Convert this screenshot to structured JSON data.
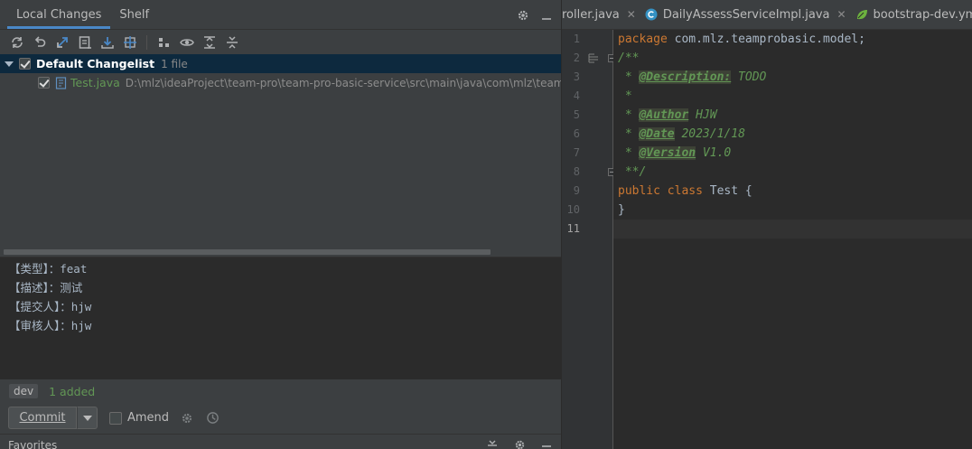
{
  "changes_panel": {
    "tabs": [
      {
        "label": "Local Changes",
        "active": true
      },
      {
        "label": "Shelf",
        "active": false
      }
    ],
    "header_icons": [
      "gear-icon",
      "minimize-icon"
    ],
    "toolbar_icons": [
      "refresh-icon",
      "rollback-icon",
      "diff-icon",
      "changelist-icon",
      "update-icon",
      "shelve-icon",
      "group-by-icon",
      "preview-icon",
      "expand-all-icon",
      "collapse-all-icon"
    ],
    "changelist": {
      "name": "Default Changelist",
      "count": "1 file",
      "files": [
        {
          "name": "Test.java",
          "path": "D:\\mlz\\ideaProject\\team-pro\\team-pro-basic-service\\src\\main\\java\\com\\mlz\\teamp"
        }
      ]
    },
    "commit_message": [
      "【类型】：feat",
      "【描述】：测试",
      "【提交人】：hjw",
      "【审核人】：hjw"
    ],
    "branch": "dev",
    "branch_status": "1 added",
    "commit_button": "Commit",
    "amend_label": "Amend",
    "colors": {
      "accent": "#4a88c7",
      "added": "#629755",
      "selection": "#0d293e"
    }
  },
  "favorites": {
    "title": "Favorites"
  },
  "editor": {
    "tabs": [
      {
        "label": "roller.java",
        "icon": "close-icon"
      },
      {
        "label": "DailyAssessServiceImpl.java",
        "icon": "java-class-icon"
      },
      {
        "label": "bootstrap-dev.yml",
        "icon": "spring-leaf-icon"
      }
    ],
    "close_glyph": "✕",
    "line_numbers": [
      "1",
      "2",
      "3",
      "4",
      "5",
      "6",
      "7",
      "8",
      "9",
      "10",
      "11"
    ],
    "current_line": "11",
    "code": {
      "l1_kw": "package",
      "l1_rest": " com.mlz.teamprobasic.model;",
      "l2": "/**",
      "l3_star": " * ",
      "l3_tag": "@Description:",
      "l3_val": " TODO",
      "l4": " *",
      "l5_star": " * ",
      "l5_tag": "@Author",
      "l5_val": " HJW",
      "l6_star": " * ",
      "l6_tag": "@Date",
      "l6_val": " 2023/1/18",
      "l7_star": " * ",
      "l7_tag": "@Version",
      "l7_val": " V1.0",
      "l8": " **/",
      "l9_kw1": "public",
      "l9_kw2": "class",
      "l9_rest": " Test {",
      "l10": "}"
    }
  }
}
